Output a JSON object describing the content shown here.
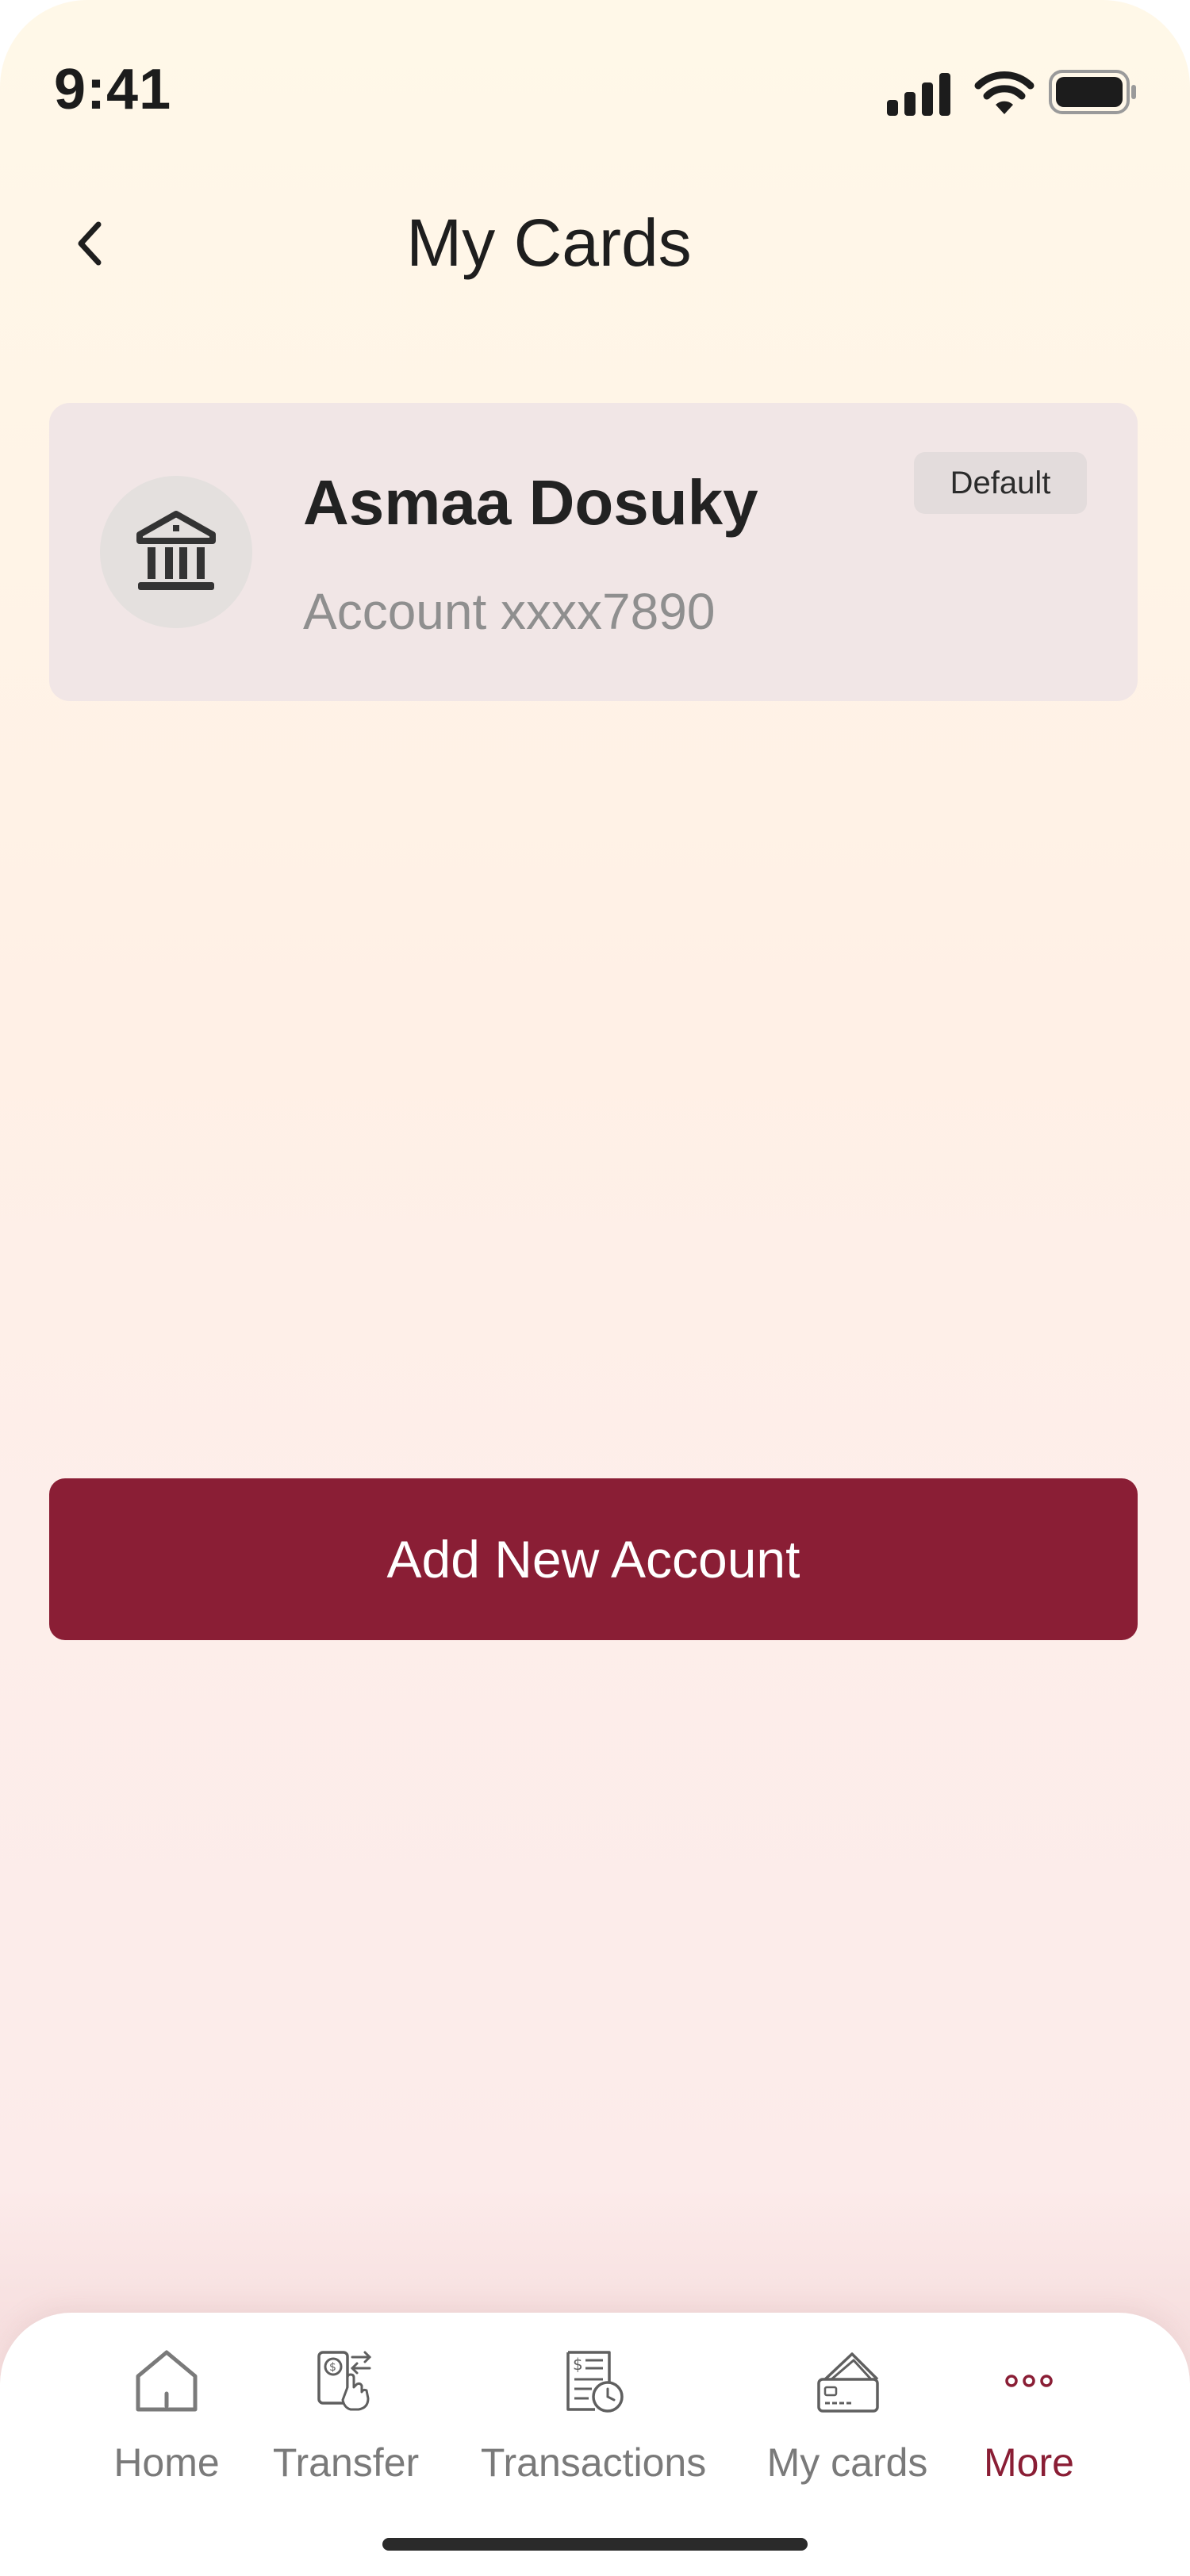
{
  "status_bar": {
    "time": "9:41"
  },
  "header": {
    "title": "My Cards"
  },
  "account_card": {
    "holder_name": "Asmaa Dosuky",
    "account_number": "Account xxxx7890",
    "badge": "Default",
    "icon": "bank-icon"
  },
  "add_button": {
    "label": "Add New Account"
  },
  "bottom_nav": {
    "items": [
      {
        "label": "Home",
        "icon": "home-icon",
        "active": false
      },
      {
        "label": "Transfer",
        "icon": "transfer-icon",
        "active": false
      },
      {
        "label": "Transactions",
        "icon": "transactions-icon",
        "active": false
      },
      {
        "label": "My cards",
        "icon": "cards-icon",
        "active": false
      },
      {
        "label": "More",
        "icon": "more-icon",
        "active": true
      }
    ]
  },
  "colors": {
    "accent": "#8a1e35",
    "card_background": "#f1e6e6",
    "inactive_nav": "#7a7a7a"
  }
}
